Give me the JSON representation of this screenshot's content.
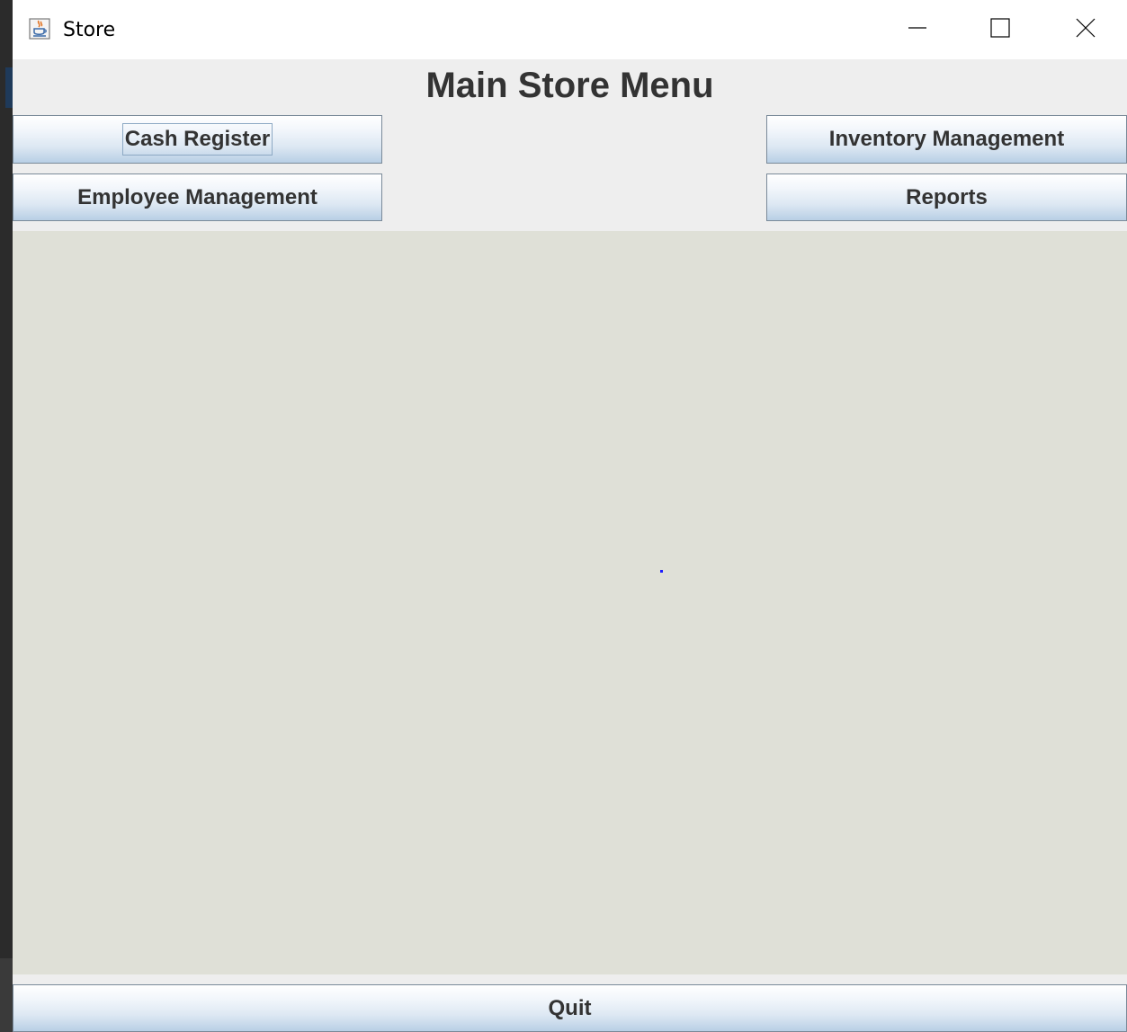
{
  "window": {
    "title": "Store"
  },
  "header": {
    "title": "Main Store Menu"
  },
  "buttons": {
    "cash_register": "Cash Register",
    "inventory_management": "Inventory Management",
    "employee_management": "Employee Management",
    "reports": "Reports",
    "quit": "Quit"
  },
  "icons": {
    "app": "java-coffee-icon",
    "minimize": "minimize-icon",
    "maximize": "maximize-icon",
    "close": "close-icon"
  },
  "colors": {
    "content_background": "#dfe0d7",
    "window_background": "#eeeeee",
    "button_text": "#333333"
  }
}
